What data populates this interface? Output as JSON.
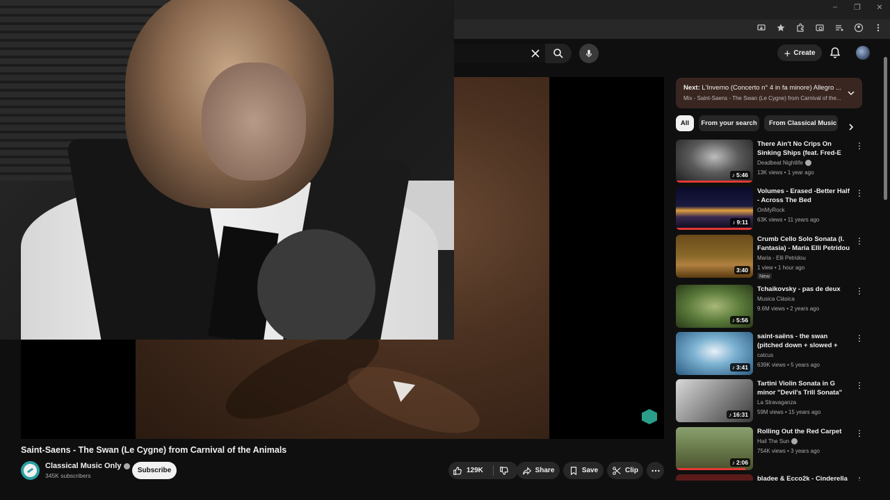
{
  "header": {
    "create_label": "Create"
  },
  "video": {
    "title": "Saint-Saens - The Swan (Le Cygne) from Carnival of the Animals",
    "channel": "Classical Music Only",
    "subscribers": "345K subscribers",
    "subscribe_label": "Subscribe",
    "likes": "129K",
    "share_label": "Share",
    "save_label": "Save",
    "clip_label": "Clip"
  },
  "next_up": {
    "prefix": "Next:",
    "title": "L'Inverno (Concerto n° 4 in fa minore) Allegro ...",
    "subtitle": "Mix - Saint-Saens - The Swan (Le Cygne) from Carnival of the..."
  },
  "chips": [
    {
      "label": "All",
      "active": true
    },
    {
      "label": "From your search",
      "active": false
    },
    {
      "label": "From Classical Music O",
      "active": false
    }
  ],
  "recommendations": [
    {
      "title": "There Ain't No Crips On Sinking Ships (feat. Fred-E from ...",
      "channel": "Deadbeat Nightlife",
      "verified": true,
      "meta": "13K views • 1 year ago",
      "duration": "5:46",
      "music": true,
      "progress": 1.0,
      "badge": ""
    },
    {
      "title": "Volumes - Erased -Better Half - Across The Bed",
      "channel": "OnMyRock",
      "verified": false,
      "meta": "63K views • 11 years ago",
      "duration": "9:11",
      "music": true,
      "progress": 1.0,
      "badge": ""
    },
    {
      "title": "Crumb Cello Solo Sonata (I. Fantasia) - Maria Elli Petridou ...",
      "channel": "Maria - Elli Petridou",
      "verified": false,
      "meta": "1 view • 1 hour ago",
      "duration": "3:40",
      "music": false,
      "progress": 0,
      "badge": "New"
    },
    {
      "title": "Tchaikovsky - pas de deux",
      "channel": "Musica Clásica",
      "verified": false,
      "meta": "9.6M views • 2 years ago",
      "duration": "5:56",
      "music": true,
      "progress": 0,
      "badge": ""
    },
    {
      "title": "saint-saëns - the swan (pitched down + slowed + reverb)",
      "channel": "catcus",
      "verified": false,
      "meta": "639K views • 5 years ago",
      "duration": "3:41",
      "music": true,
      "progress": 0,
      "badge": ""
    },
    {
      "title": "Tartini Violin Sonata in G minor \"Devil's Trill Sonata\"",
      "channel": "La Stravaganza",
      "verified": false,
      "meta": "59M views • 15 years ago",
      "duration": "16:31",
      "music": true,
      "progress": 0,
      "badge": ""
    },
    {
      "title": "Rolling Out the Red Carpet",
      "channel": "Hail The Sun",
      "verified": true,
      "meta": "754K views • 3 years ago",
      "duration": "2:06",
      "music": true,
      "progress": 0.9,
      "badge": ""
    },
    {
      "title": "bladee & Ecco2k - Cinderella",
      "channel": "",
      "verified": false,
      "meta": "",
      "duration": "",
      "music": false,
      "progress": 0,
      "badge": ""
    }
  ],
  "colors": {
    "accent_red": "#e53935",
    "channel_teal": "#2b9ea2",
    "next_card_bg": "#3a2620"
  }
}
